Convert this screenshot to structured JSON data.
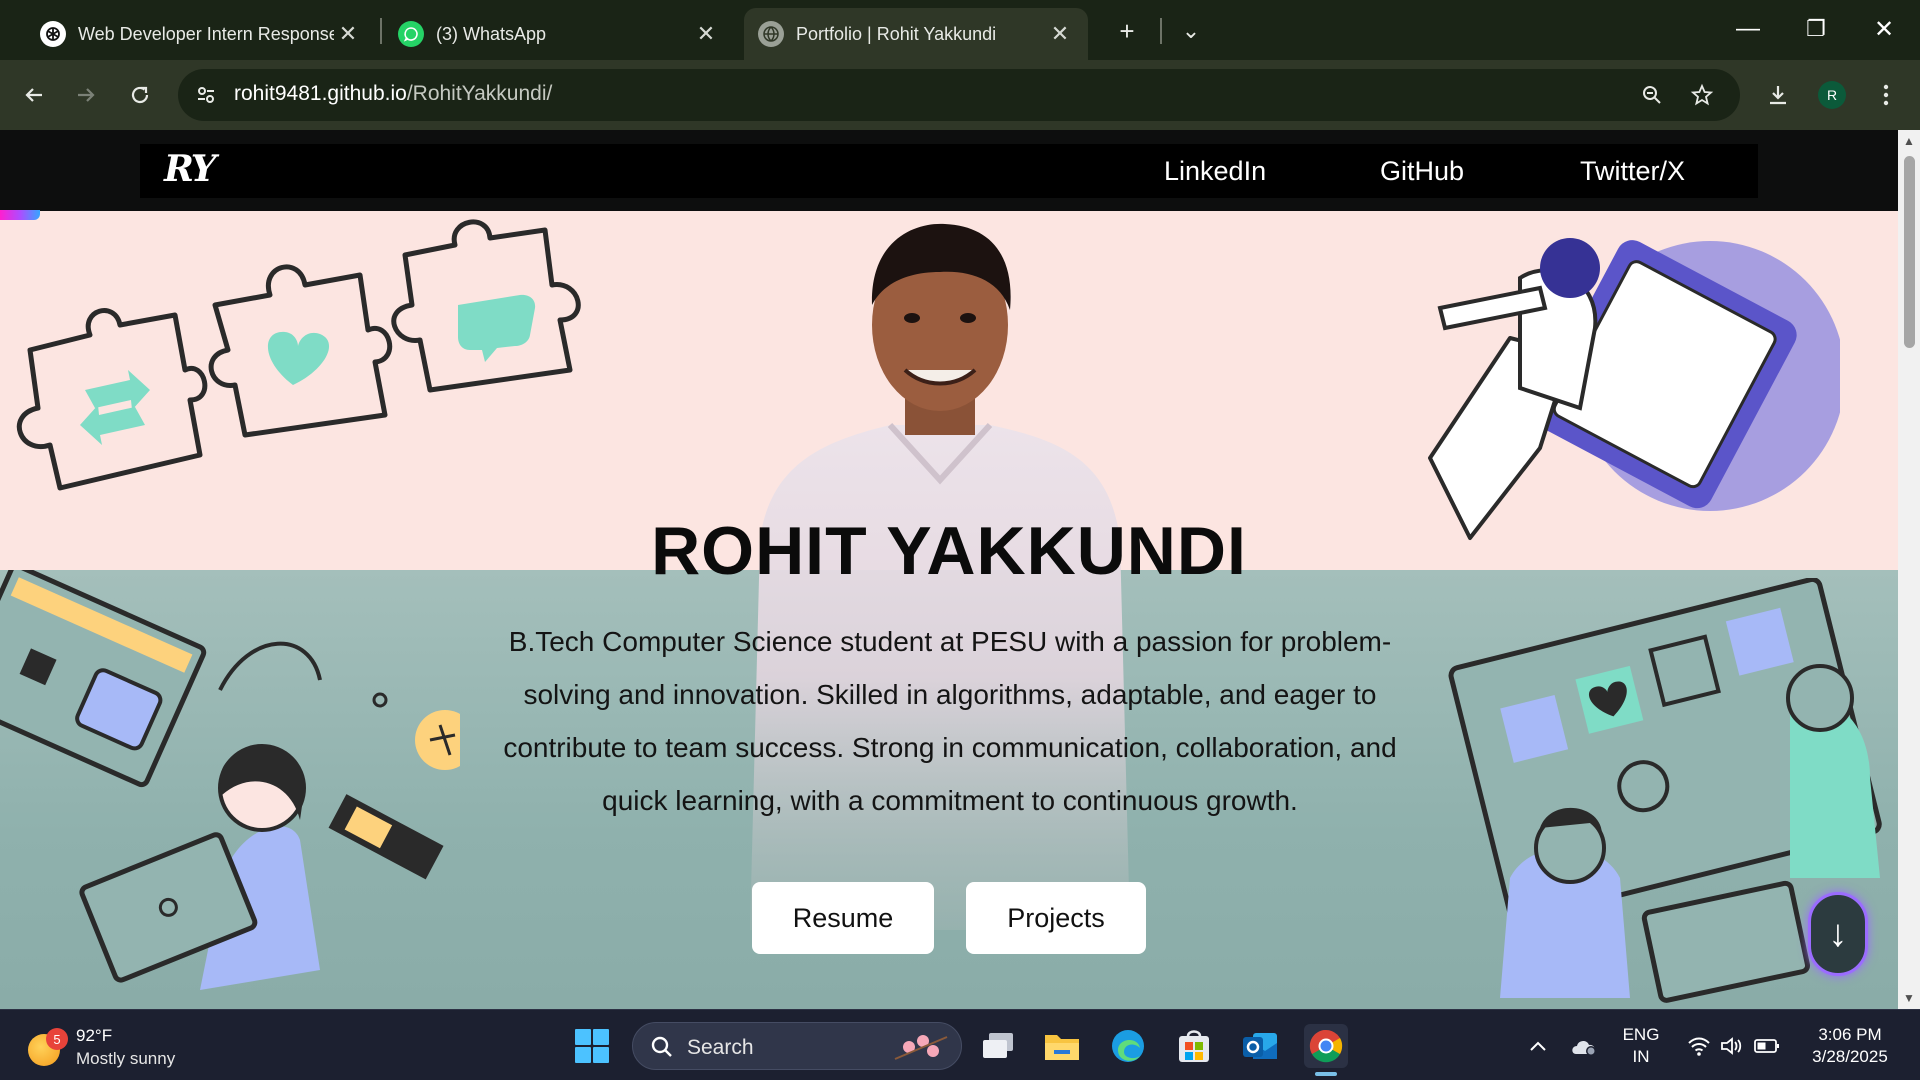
{
  "browser": {
    "tabs": [
      {
        "title": "Web Developer Intern Response",
        "favicon": "openai-icon",
        "active": false
      },
      {
        "title": "(3) WhatsApp",
        "favicon": "whatsapp-icon",
        "active": false
      },
      {
        "title": "Portfolio | Rohit Yakkundi",
        "favicon": "globe-icon",
        "active": true
      }
    ],
    "tab_close_glyph": "✕",
    "new_tab_glyph": "+",
    "tab_search_glyph": "⌄",
    "window": {
      "minimize": "—",
      "restore": "❐",
      "close": "✕"
    },
    "address": {
      "host": "rohit9481.github.io",
      "path": "/RohitYakkundi/"
    },
    "profile_initial": "R"
  },
  "navbar": {
    "logo": "RY",
    "links": [
      "LinkedIn",
      "GitHub",
      "Twitter/X"
    ]
  },
  "hero": {
    "name": "ROHIT YAKKUNDI",
    "description": "B.Tech Computer Science student at PESU with a passion for problem-solving and innovation. Skilled in algorithms, adaptable, and eager to contribute to team success. Strong in communication, collaboration, and quick learning, with a commitment to continuous growth.",
    "buttons": {
      "resume": "Resume",
      "projects": "Projects"
    },
    "scroll_glyph": "↓"
  },
  "colors": {
    "hero_top": "#fce5e1",
    "hero_bottom": "#93b4b0",
    "navbar": "#000000",
    "accent_purple": "#5b55c9",
    "accent_mint": "#7fdcc6",
    "accent_yellow": "#fdd27d"
  },
  "taskbar": {
    "weather": {
      "temp": "92°F",
      "condition": "Mostly sunny",
      "badge": "5"
    },
    "search_label": "Search",
    "language": {
      "line1": "ENG",
      "line2": "IN"
    },
    "clock": {
      "time": "3:06 PM",
      "date": "3/28/2025"
    }
  }
}
